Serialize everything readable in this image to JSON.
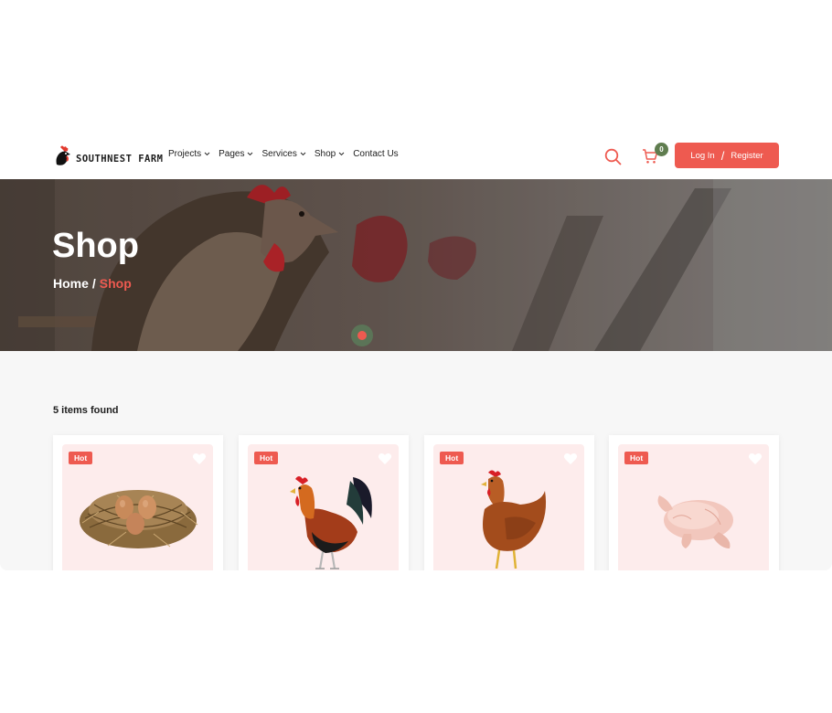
{
  "brand": {
    "name": "SOUTHNEST FARM"
  },
  "nav": [
    {
      "label": "Projects",
      "dropdown": true
    },
    {
      "label": "Pages",
      "dropdown": true
    },
    {
      "label": "Services",
      "dropdown": true
    },
    {
      "label": "Shop",
      "dropdown": true
    },
    {
      "label": "Contact Us",
      "dropdown": false
    }
  ],
  "header": {
    "cart_count": "0",
    "login_label": "Log In",
    "auth_separator": "/",
    "register_label": "Register"
  },
  "hero": {
    "title": "Shop",
    "breadcrumb": {
      "home": "Home",
      "separator": "/",
      "current": "Shop"
    }
  },
  "results": {
    "found_text": "5 items found"
  },
  "products": [
    {
      "badge": "Hot",
      "image": "eggs-in-nest"
    },
    {
      "badge": "Hot",
      "image": "rooster"
    },
    {
      "badge": "Hot",
      "image": "hen"
    },
    {
      "badge": "Hot",
      "image": "raw-chicken"
    }
  ],
  "colors": {
    "accent": "#ee5a50",
    "badge_green": "#5f7d4f",
    "card_bg": "#fdecec",
    "page_bg": "#f7f7f7"
  }
}
